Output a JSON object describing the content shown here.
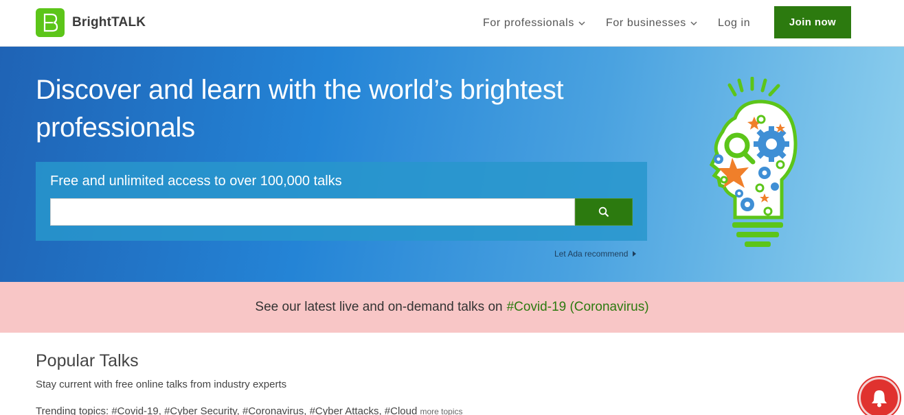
{
  "header": {
    "brand": "BrightTALK",
    "nav": {
      "for_professionals": "For professionals",
      "for_businesses": "For businesses",
      "login": "Log in"
    },
    "join_label": "Join now"
  },
  "hero": {
    "title": "Discover and learn with the world’s brightest professionals",
    "search_label": "Free and unlimited access to over 100,000 talks",
    "search_value": "",
    "ada_link": "Let Ada recommend"
  },
  "banner": {
    "text": "See our latest live and on-demand talks on",
    "link": "#Covid-19 (Coronavirus)"
  },
  "popular": {
    "title": "Popular Talks",
    "subtitle": "Stay current with free online talks from industry experts",
    "trending_label": "Trending topics:",
    "topics": [
      "#Covid-19,",
      "#Cyber Security,",
      "#Coronavirus,",
      "#Cyber Attacks,",
      "#Cloud"
    ],
    "more_topics": "more topics"
  },
  "colors": {
    "brand_green": "#5cc519",
    "button_green": "#2c7a0f",
    "banner_pink": "#f8c6c6",
    "bell_red": "#e0322f"
  },
  "icons": {
    "logo": "brighttalk-b-logo-icon",
    "chevron": "chevron-down-icon",
    "search": "search-icon",
    "ada_arrow": "triangle-right-icon",
    "hero_art": "lightbulb-head-icon",
    "bell": "bell-icon"
  }
}
